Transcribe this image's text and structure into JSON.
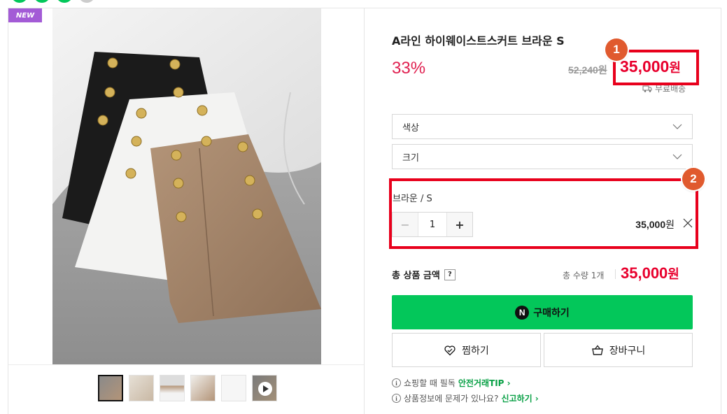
{
  "badge": {
    "new_label": "NEW"
  },
  "product": {
    "title": "A라인 하이웨이스트스커트 브라운 S",
    "discount": "33%",
    "original_price": "52,240원",
    "sale_price_number": "35,000",
    "sale_price_unit": "원",
    "shipping": "무료배송"
  },
  "selects": {
    "color_label": "색상",
    "size_label": "크기"
  },
  "selected_option": {
    "name": "브라운 / S",
    "quantity": "1",
    "price_number": "35,000",
    "price_unit": "원",
    "minus": "−",
    "plus": "+"
  },
  "total": {
    "label": "총 상품 금액",
    "help": "?",
    "quantity_text": "총 수량 1개",
    "price_number": "35,000",
    "price_unit": "원"
  },
  "buttons": {
    "n_logo": "N",
    "buy": "구매하기",
    "wish": "찜하기",
    "cart": "장바구니"
  },
  "info": {
    "icon": "i",
    "line1_text": "쇼핑할 때 필독",
    "line1_link": "안전거래TIP ›",
    "line2_text": "상품정보에 문제가 있나요?",
    "line2_link": "신고하기 ›"
  },
  "annotations": {
    "badge1": "1",
    "badge2": "2"
  },
  "colors": {
    "brand_green": "#03c75a",
    "price_red": "#e8002d",
    "discount_pink": "#e02050",
    "highlight_red": "#e8001c",
    "badge_orange": "#e05a2e",
    "new_badge_purple": "#a35bd6"
  },
  "thumbnails": [
    "thumb-1",
    "thumb-2",
    "thumb-3",
    "thumb-4",
    "thumb-5",
    "thumb-video"
  ]
}
